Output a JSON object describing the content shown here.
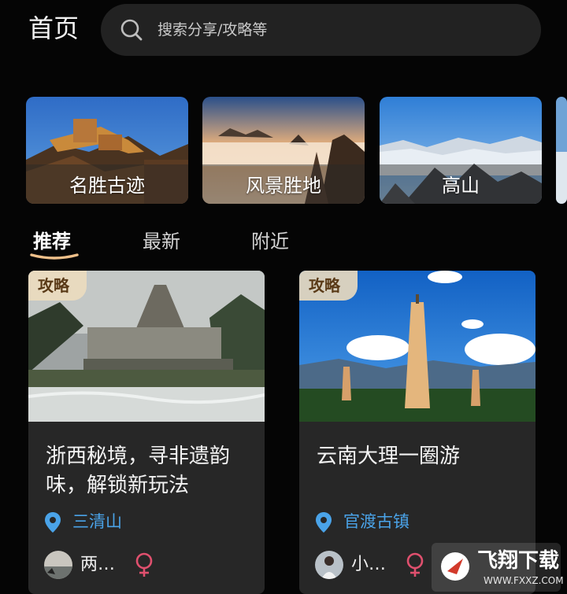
{
  "header": {
    "title": "首页",
    "search_placeholder": "搜索分享/攻略等",
    "search_icon": "search-icon"
  },
  "categories": [
    {
      "label": "名胜古迹"
    },
    {
      "label": "风景胜地"
    },
    {
      "label": "高山"
    }
  ],
  "tabs": [
    {
      "label": "推荐",
      "active": true
    },
    {
      "label": "最新",
      "active": false
    },
    {
      "label": "附近",
      "active": false
    }
  ],
  "cards": [
    {
      "tag": "攻略",
      "title": "浙西秘境，寻非遗韵味，解锁新玩法",
      "location": "三清山",
      "author": "两…",
      "location_icon": "location-pin-icon",
      "gender_icon": "female-icon"
    },
    {
      "tag": "攻略",
      "title": "云南大理一圈游",
      "location": "官渡古镇",
      "author": "小…",
      "location_icon": "location-pin-icon",
      "gender_icon": "female-icon"
    }
  ],
  "watermark": {
    "title": "飞翔下载",
    "site": "WWW.FXXZ.COM"
  },
  "colors": {
    "background": "#050505",
    "card": "#272727",
    "accent_location": "#4aa3e8",
    "gender": "#e0506e",
    "tag": "#ecdcbe"
  }
}
